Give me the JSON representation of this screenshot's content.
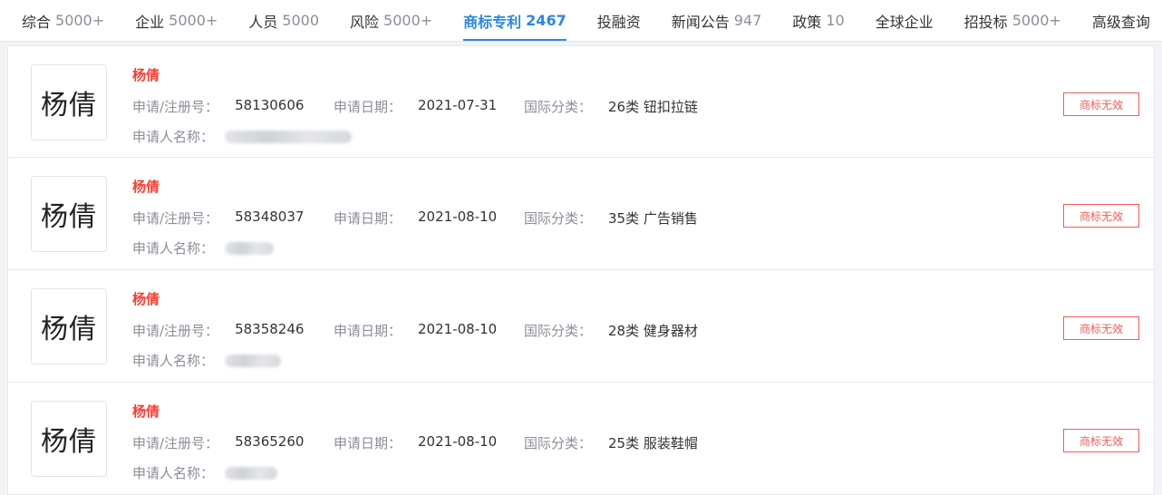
{
  "tabs": [
    {
      "label": "综合",
      "count": "5000+",
      "active": false
    },
    {
      "label": "企业",
      "count": "5000+",
      "active": false
    },
    {
      "label": "人员",
      "count": "5000",
      "active": false
    },
    {
      "label": "风险",
      "count": "5000+",
      "active": false
    },
    {
      "label": "商标专利",
      "count": "2467",
      "active": true
    },
    {
      "label": "投融资",
      "count": "",
      "active": false
    },
    {
      "label": "新闻公告",
      "count": "947",
      "active": false
    },
    {
      "label": "政策",
      "count": "10",
      "active": false
    },
    {
      "label": "全球企业",
      "count": "",
      "active": false
    },
    {
      "label": "招投标",
      "count": "5000+",
      "active": false
    },
    {
      "label": "高级查询",
      "count": "",
      "active": false
    }
  ],
  "labels": {
    "reg_no": "申请/注册号：",
    "apply_date": "申请日期：",
    "intl_class": "国际分类：",
    "applicant": "申请人名称："
  },
  "results": [
    {
      "logo_text": "杨倩",
      "name": "杨倩",
      "reg_no": "58130606",
      "apply_date": "2021-07-31",
      "intl_class": "26类 钮扣拉链",
      "status": "商标无效"
    },
    {
      "logo_text": "杨倩",
      "name": "杨倩",
      "reg_no": "58348037",
      "apply_date": "2021-08-10",
      "intl_class": "35类 广告销售",
      "status": "商标无效"
    },
    {
      "logo_text": "杨倩",
      "name": "杨倩",
      "reg_no": "58358246",
      "apply_date": "2021-08-10",
      "intl_class": "28类 健身器材",
      "status": "商标无效"
    },
    {
      "logo_text": "杨倩",
      "name": "杨倩",
      "reg_no": "58365260",
      "apply_date": "2021-08-10",
      "intl_class": "25类 服装鞋帽",
      "status": "商标无效"
    }
  ]
}
